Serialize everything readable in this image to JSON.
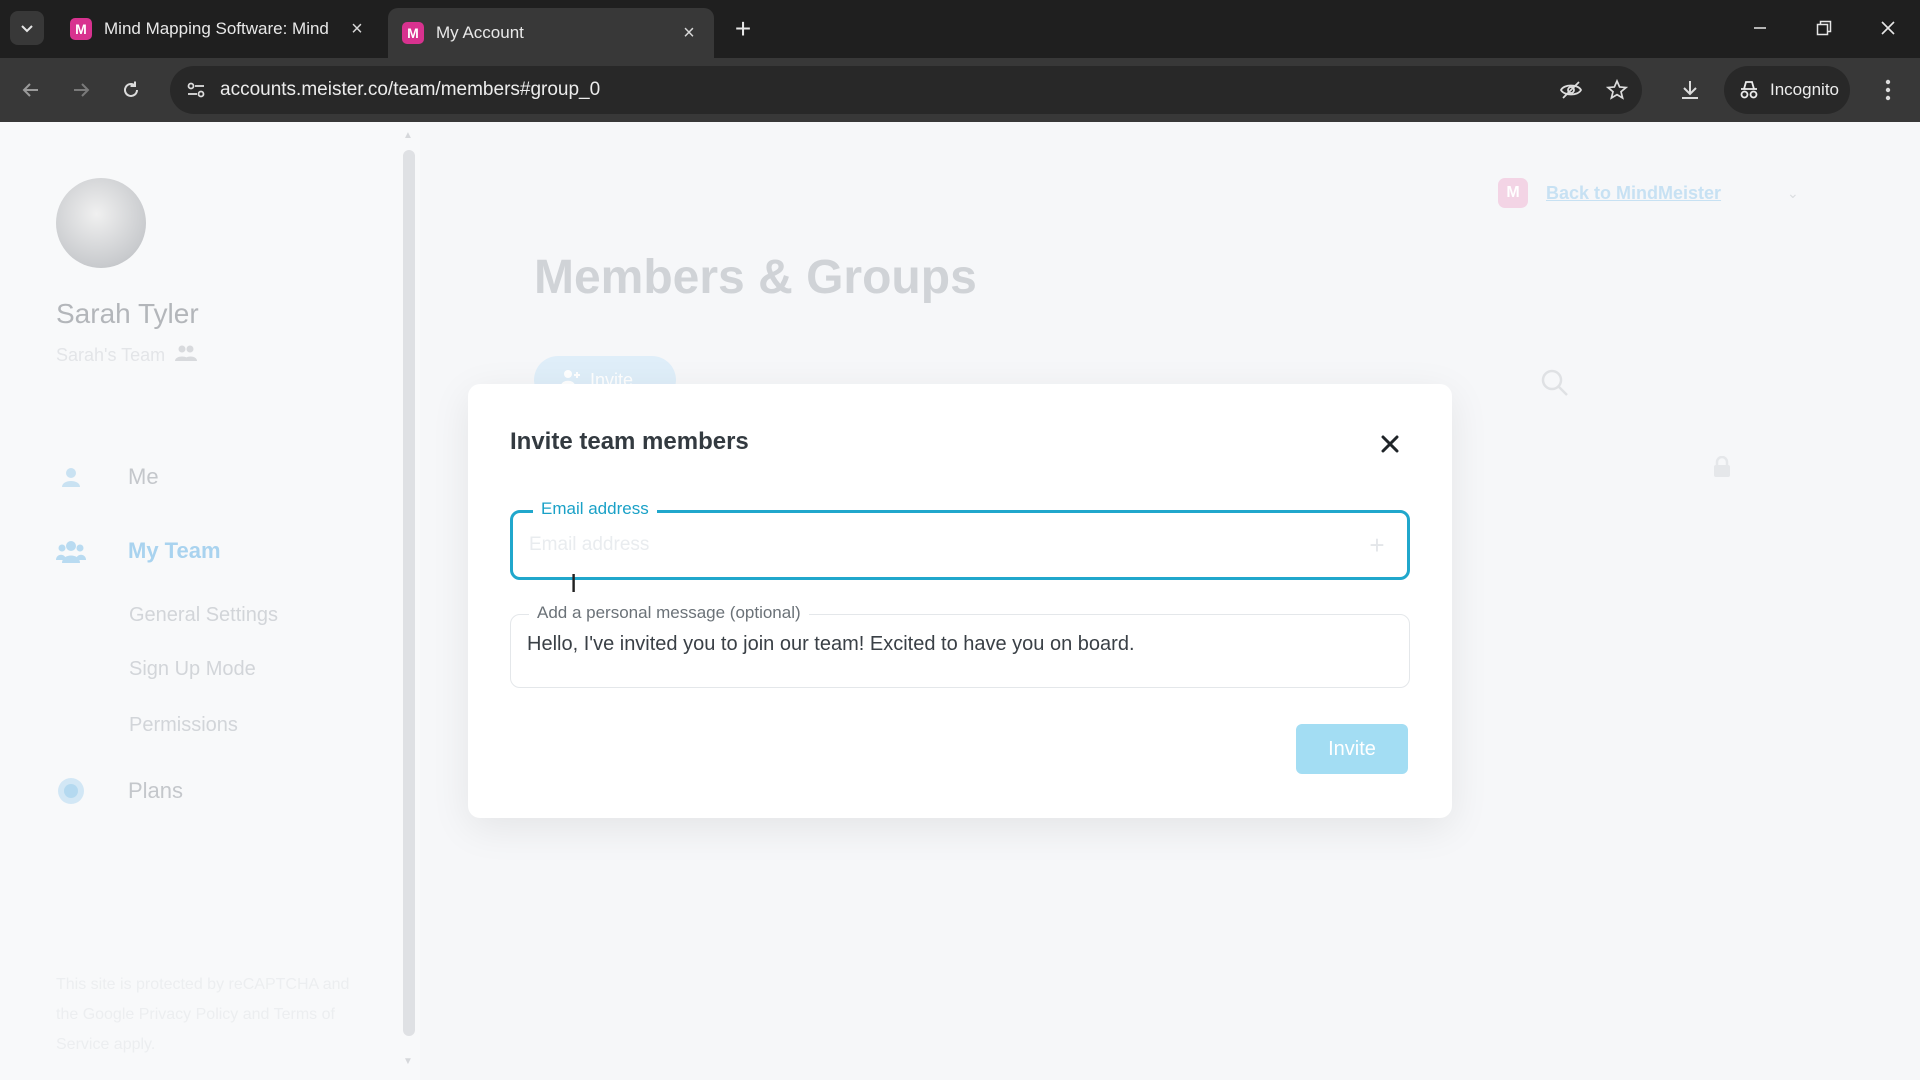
{
  "browser": {
    "tabs": [
      {
        "title": "Mind Mapping Software: Mind",
        "favicon": "M"
      },
      {
        "title": "My Account",
        "favicon": "M"
      }
    ],
    "url": "accounts.meister.co/team/members#group_0",
    "incognito_label": "Incognito"
  },
  "sidebar": {
    "user_name": "Sarah Tyler",
    "team_name": "Sarah's Team",
    "nav": [
      {
        "label": "Me",
        "icon": "person-icon"
      },
      {
        "label": "My Team",
        "icon": "team-icon",
        "active": true
      },
      {
        "label": "Plans",
        "icon": "plans-icon"
      }
    ],
    "subnav": [
      "General Settings",
      "Sign Up Mode",
      "Permissions"
    ],
    "recaptcha": "This site is protected by reCAPTCHA and the Google Privacy Policy and Terms of Service apply."
  },
  "main": {
    "title": "Members & Groups",
    "invite_button": "Invite",
    "back_link": "Back to MindMeister"
  },
  "modal": {
    "title": "Invite team members",
    "email_label": "Email address",
    "email_placeholder": "Email address",
    "email_value": "",
    "message_label": "Add a personal message (optional)",
    "message_value": "Hello, I've invited you to join our team! Excited to have you on board.",
    "invite_label": "Invite"
  },
  "colors": {
    "accent": "#20a7cc",
    "invite_button": "#a3ddf3",
    "favicon": "#d8328f"
  }
}
